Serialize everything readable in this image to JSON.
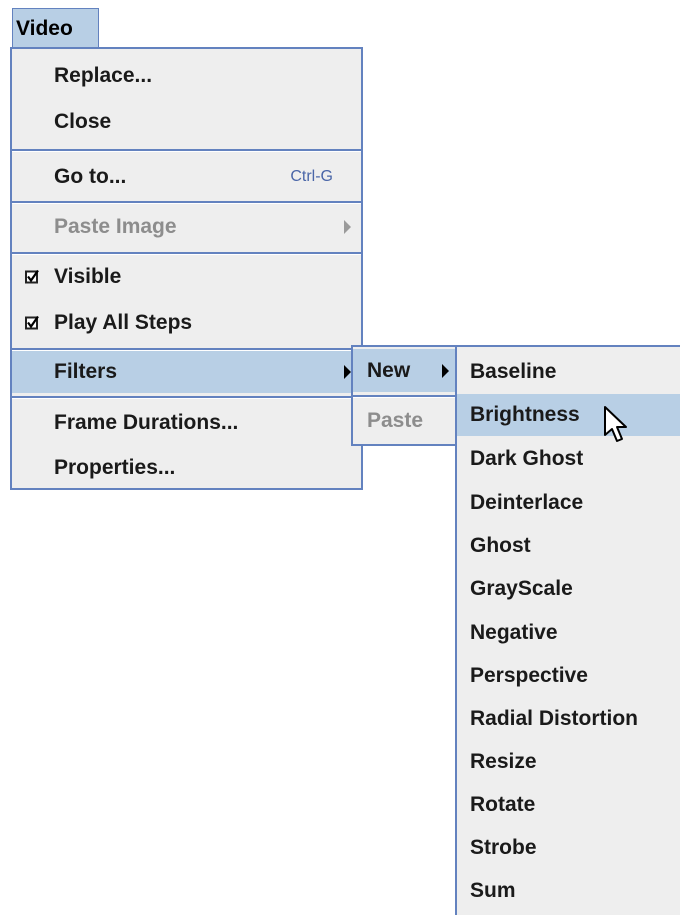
{
  "menu_title": "Video",
  "main_menu": {
    "replace": "Replace...",
    "close": "Close",
    "goto": "Go to...",
    "goto_shortcut": "Ctrl-G",
    "paste_image": "Paste Image",
    "visible": "Visible",
    "play_all_steps": "Play All Steps",
    "filters": "Filters",
    "frame_durations": "Frame Durations...",
    "properties": "Properties..."
  },
  "filters_submenu": {
    "new": "New",
    "paste": "Paste"
  },
  "new_submenu": {
    "items": [
      "Baseline",
      "Brightness",
      "Dark Ghost",
      "Deinterlace",
      "Ghost",
      "GrayScale",
      "Negative",
      "Perspective",
      "Radial Distortion",
      "Resize",
      "Rotate",
      "Strobe",
      "Sum"
    ],
    "selected": "Brightness"
  },
  "state": {
    "visible_checked": true,
    "play_all_steps_checked": true,
    "paste_image_enabled": false,
    "paste_enabled": false
  },
  "colors": {
    "selection": "#b8cfe5",
    "border": "#6382bf",
    "background": "#eeeeee",
    "disabled_text": "#8d8d8d",
    "accelerator": "#4a66a8"
  },
  "icons": [
    "check-icon",
    "submenu-arrow-icon",
    "mouse-pointer-icon"
  ]
}
